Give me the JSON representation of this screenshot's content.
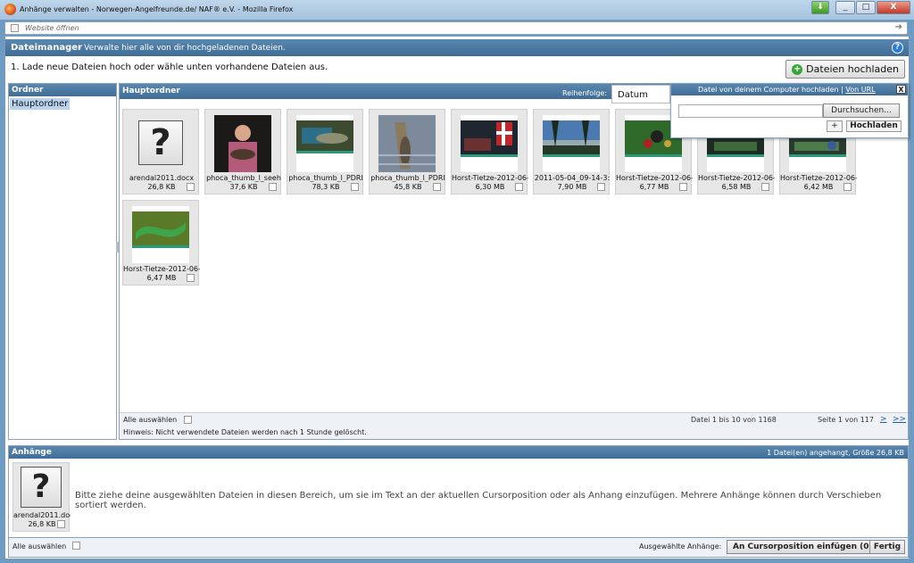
{
  "window": {
    "title": "Anhänge verwalten - Norwegen-Angelfreunde.de/ NAF® e.V. - Mozilla Firefox",
    "url_placeholder": "Website öffnen",
    "btn_min": "_",
    "btn_max": "□",
    "btn_close": "X"
  },
  "header": {
    "title": "Dateimanager",
    "description": "- Verwalte hier alle von dir hochgeladenen Dateien.",
    "help": "?"
  },
  "instruction": "1. Lade neue Dateien hoch oder wähle unten vorhandene Dateien aus.",
  "upload_button": "Dateien hochladen",
  "folders": {
    "title": "Ordner",
    "items": [
      "Hauptordner"
    ]
  },
  "main": {
    "title": "Hauptordner",
    "sort_label": "Reihenfolge:",
    "sort_value": "Datum"
  },
  "files": [
    {
      "name": "arendal2011.docx",
      "size": "26,8 KB",
      "kind": "unknown-file-icon"
    },
    {
      "name": "phoca_thumb_l_seeh",
      "size": "37,6 KB",
      "kind": "photo"
    },
    {
      "name": "phoca_thumb_l_PDRI",
      "size": "78,3 KB",
      "kind": "photo"
    },
    {
      "name": "phoca_thumb_l_PDRI",
      "size": "45,8 KB",
      "kind": "photo"
    },
    {
      "name": "Horst-Tietze-2012-06-",
      "size": "6,30 MB",
      "kind": "photo"
    },
    {
      "name": "2011-05-04_09-14-3:",
      "size": "7,90 MB",
      "kind": "photo"
    },
    {
      "name": "Horst-Tietze-2012-06-",
      "size": "6,77 MB",
      "kind": "photo"
    },
    {
      "name": "Horst-Tietze-2012-06-",
      "size": "6,58 MB",
      "kind": "photo"
    },
    {
      "name": "Horst-Tietze-2012-06-",
      "size": "6,42 MB",
      "kind": "photo"
    },
    {
      "name": "Horst-Tietze-2012-06-",
      "size": "6,47 MB",
      "kind": "photo"
    }
  ],
  "main_footer": {
    "select_all": "Alle auswählen",
    "hint": "Hinweis: Nicht verwendete Dateien werden nach 1 Stunde gelöscht.",
    "range": "Datei 1 bis 10 von 1168",
    "page": "Seite 1 von 117",
    "next": ">",
    "last": ">>"
  },
  "upload_popup": {
    "text": "Datei von deinem Computer hochladen |",
    "url_link": "Von URL",
    "close": "X",
    "browse": "Durchsuchen...",
    "add": "+",
    "upload": "Hochladen"
  },
  "attachments": {
    "title": "Anhänge",
    "info": "1 Datei(en) angehangt, Größe 26,8 KB",
    "description": "Bitte ziehe deine ausgewählten Dateien in diesen Bereich, um sie im Text an der aktuellen Cursorposition oder als Anhang einzufügen. Mehrere Anhänge können durch Verschieben sortiert werden.",
    "file": {
      "name": "arendal2011.docx",
      "size": "26,8 KB"
    },
    "select_all": "Alle auswählen",
    "selected_label": "Ausgewählte Anhänge:",
    "insert_button": "An Cursorposition einfügen (0)",
    "done_button": "Fertig"
  }
}
